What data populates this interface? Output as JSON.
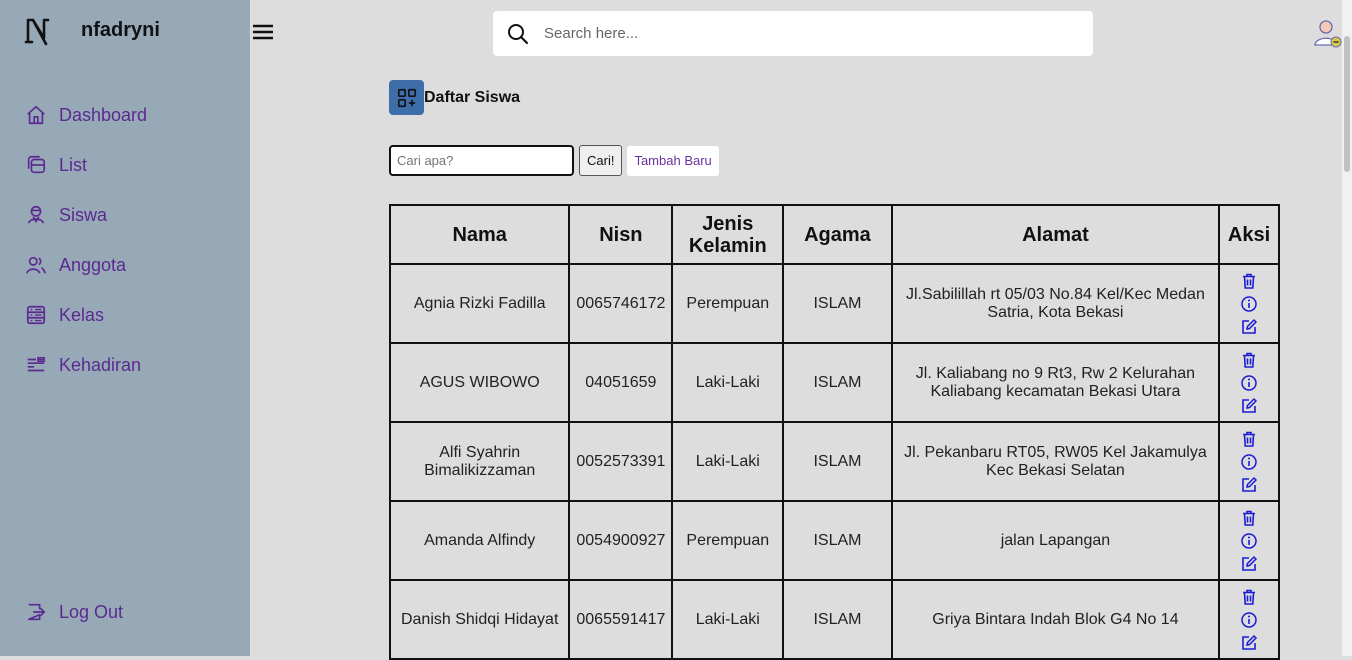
{
  "brand": {
    "name": "nfadryni",
    "logo_icon": "n-logo-icon"
  },
  "sidebar": {
    "items": [
      {
        "label": "Dashboard",
        "icon": "home-icon"
      },
      {
        "label": "List",
        "icon": "files-icon"
      },
      {
        "label": "Siswa",
        "icon": "student-icon"
      },
      {
        "label": "Anggota",
        "icon": "users-icon"
      },
      {
        "label": "Kelas",
        "icon": "server-icon"
      },
      {
        "label": "Kehadiran",
        "icon": "list-icon"
      }
    ],
    "logout": {
      "label": "Log Out",
      "icon": "logout-icon"
    }
  },
  "header": {
    "search_placeholder": "Search here..."
  },
  "page": {
    "title": "Daftar Siswa",
    "search_placeholder": "Cari apa?",
    "search_button": "Cari!",
    "add_button": "Tambah Baru"
  },
  "table": {
    "headers": [
      "Nama",
      "Nisn",
      "Jenis Kelamin",
      "Agama",
      "Alamat",
      "Aksi"
    ],
    "rows": [
      {
        "nama": "Agnia Rizki Fadilla",
        "nisn": "0065746172",
        "jk": "Perempuan",
        "agama": "ISLAM",
        "alamat": "Jl.Sabilillah rt 05/03 No.84 Kel/Kec Medan Satria, Kota Bekasi"
      },
      {
        "nama": "AGUS WIBOWO",
        "nisn": "04051659",
        "jk": "Laki-Laki",
        "agama": "ISLAM",
        "alamat": "Jl. Kaliabang no 9 Rt3, Rw 2 Kelurahan Kaliabang kecamatan Bekasi Utara"
      },
      {
        "nama": "Alfi Syahrin Bimalikizzaman",
        "nisn": "0052573391",
        "jk": "Laki-Laki",
        "agama": "ISLAM",
        "alamat": "Jl. Pekanbaru RT05, RW05 Kel Jakamulya Kec Bekasi Selatan"
      },
      {
        "nama": "Amanda Alfindy",
        "nisn": "0054900927",
        "jk": "Perempuan",
        "agama": "ISLAM",
        "alamat": "jalan Lapangan"
      },
      {
        "nama": "Danish Shidqi Hidayat",
        "nisn": "0065591417",
        "jk": "Laki-Laki",
        "agama": "ISLAM",
        "alamat": "Griya Bintara Indah Blok G4 No 14"
      }
    ]
  },
  "colors": {
    "sidebar_bg": "#97a9b7",
    "accent": "#5b2a91",
    "action_icon": "#1c1cd6",
    "page_bg": "#dddddd"
  }
}
